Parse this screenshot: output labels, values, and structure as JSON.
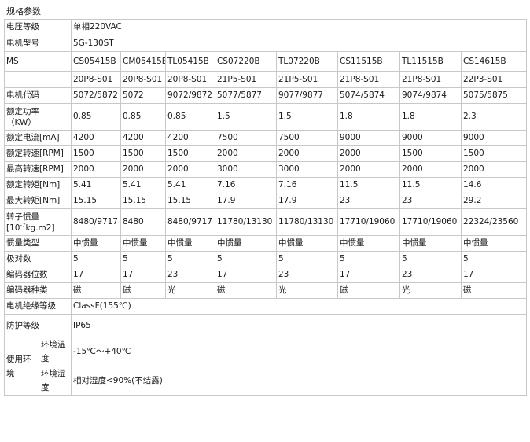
{
  "title": "规格参数",
  "voltage": {
    "label": "电压等级",
    "value": "单相220VAC"
  },
  "motor_model": {
    "label": "电机型号",
    "value": "5G-130ST"
  },
  "ms": {
    "label": "MS",
    "models": [
      "CS05415B",
      "CM05415B",
      "TL05415B",
      "CS07220B",
      "TL07220B",
      "CS11515B",
      "TL11515B",
      "CS14615B"
    ],
    "suffixes": [
      "20P8-S01",
      "20P8-S01",
      "20P8-S01",
      "21P5-S01",
      "21P5-S01",
      "21P8-S01",
      "21P8-S01",
      "22P3-S01"
    ]
  },
  "code": {
    "label": "电机代码",
    "values": [
      "5072/5872",
      "5072",
      "9072/9872",
      "5077/5877",
      "9077/9877",
      "5074/5874",
      "9074/9874",
      "5075/5875"
    ]
  },
  "power": {
    "label": "额定功率",
    "unit": "（KW）",
    "values": [
      "0.85",
      "0.85",
      "0.85",
      "1.5",
      "1.5",
      "1.8",
      "1.8",
      "2.3"
    ]
  },
  "current": {
    "label": "额定电流[mA]",
    "values": [
      "4200",
      "4200",
      "4200",
      "7500",
      "7500",
      "9000",
      "9000",
      "9000"
    ]
  },
  "rated_speed": {
    "label": "额定转速[RPM]",
    "values": [
      "1500",
      "1500",
      "1500",
      "2000",
      "2000",
      "2000",
      "1500",
      "1500"
    ]
  },
  "max_speed": {
    "label": "最高转速[RPM]",
    "values": [
      "2000",
      "2000",
      "2000",
      "3000",
      "3000",
      "2000",
      "2000",
      "2000"
    ]
  },
  "rated_torque": {
    "label": "额定转矩[Nm]",
    "values": [
      "5.41",
      "5.41",
      "5.41",
      "7.16",
      "7.16",
      "11.5",
      "11.5",
      "14.6"
    ]
  },
  "max_torque": {
    "label": "最大转矩[Nm]",
    "values": [
      "15.15",
      "15.15",
      "15.15",
      "17.9",
      "17.9",
      "23",
      "23",
      "29.2"
    ]
  },
  "inertia": {
    "label": "转子惯量",
    "unit_pre": "[10",
    "unit_sup": "-7",
    "unit_post": "kg.m2]",
    "values": [
      "8480/9717",
      "8480",
      "8480/9717",
      "11780/13130",
      "11780/13130",
      "17710/19060",
      "17710/19060",
      "22324/23560"
    ]
  },
  "inertia_type": {
    "label": "惯量类型",
    "values": [
      "中惯量",
      "中惯量",
      "中惯量",
      "中惯量",
      "中惯量",
      "中惯量",
      "中惯量",
      "中惯量"
    ]
  },
  "poles": {
    "label": "极对数",
    "values": [
      "5",
      "5",
      "5",
      "5",
      "5",
      "5",
      "5",
      "5"
    ]
  },
  "encoder_bits": {
    "label": "编码器位数",
    "values": [
      "17",
      "17",
      "23",
      "17",
      "23",
      "17",
      "23",
      "17"
    ]
  },
  "encoder_type": {
    "label": "编码器种类",
    "values": [
      "磁",
      "磁",
      "光",
      "磁",
      "光",
      "磁",
      "光",
      "磁"
    ]
  },
  "insulation": {
    "label": "电机绝缘等级",
    "value": "ClassF(155℃)"
  },
  "protection": {
    "label": "防护等级",
    "value": "IP65"
  },
  "environment": {
    "label": "使用环境",
    "temp_label": "环境温度",
    "temp_value": "-15℃～+40℃",
    "humidity_label": "环境湿度",
    "humidity_value": "相对湿度<90%(不结露)"
  }
}
